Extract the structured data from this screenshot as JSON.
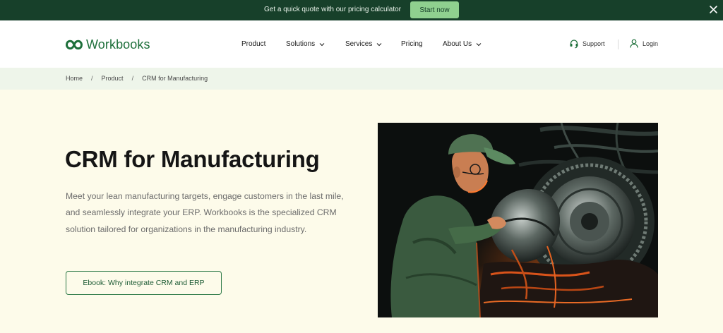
{
  "topbar": {
    "text": "Get a quick quote with our pricing calculator",
    "button": "Start now"
  },
  "header": {
    "logo": "Workbooks",
    "nav": [
      {
        "label": "Product",
        "dropdown": false
      },
      {
        "label": "Solutions",
        "dropdown": true
      },
      {
        "label": "Services",
        "dropdown": true
      },
      {
        "label": "Pricing",
        "dropdown": false
      },
      {
        "label": "About Us",
        "dropdown": true
      }
    ],
    "support": "Support",
    "login": "Login"
  },
  "breadcrumb": [
    "Home",
    "Product",
    "CRM for Manufacturing"
  ],
  "hero": {
    "title": "CRM for Manufacturing",
    "description": "Meet your lean manufacturing targets, engage customers in the last mile, and seamlessly integrate your ERP. Workbooks is the specialized CRM solution tailored for organizations in the manufacturing industry.",
    "cta": "Ebook: Why integrate CRM and ERP"
  },
  "colors": {
    "brand_dark": "#17402a",
    "brand_green": "#1d6f3a",
    "accent_button": "#8fd08f",
    "hero_bg": "#fdfbea",
    "breadcrumb_bg": "#eef5ea"
  }
}
